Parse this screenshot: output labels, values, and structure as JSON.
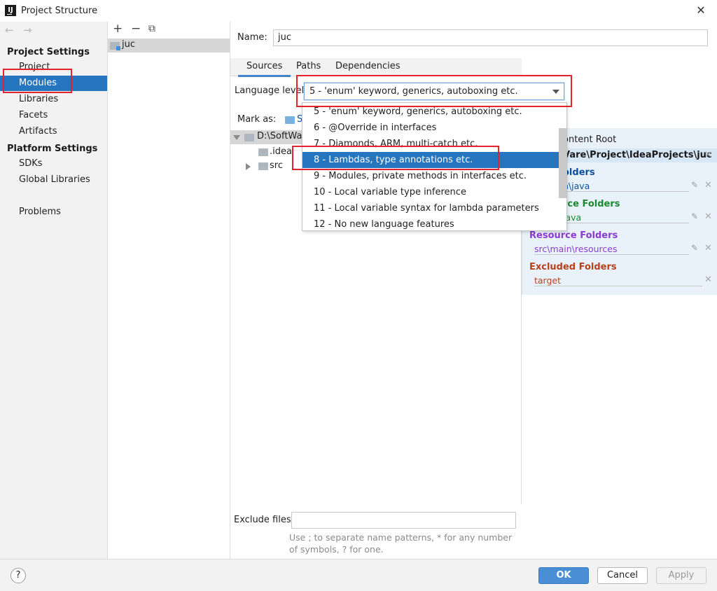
{
  "window": {
    "title": "Project Structure",
    "icon_text": "IJ"
  },
  "sidebar": {
    "back": "←",
    "forward": "→",
    "project_settings_label": "Project Settings",
    "project_items": [
      "Project",
      "Modules",
      "Libraries",
      "Facets",
      "Artifacts"
    ],
    "platform_settings_label": "Platform Settings",
    "platform_items": [
      "SDKs",
      "Global Libraries"
    ],
    "problems": "Problems",
    "selected": "Modules"
  },
  "modules": {
    "add": "+",
    "remove": "−",
    "copy": "⧉",
    "list": [
      "juc"
    ]
  },
  "module_settings": {
    "name_label": "Name:",
    "name_value": "juc",
    "tabs": [
      "Sources",
      "Paths",
      "Dependencies"
    ],
    "active_tab": "Sources",
    "language_level_label": "Language level:",
    "language_level_value": "5 - 'enum' keyword, generics, autoboxing etc.",
    "mark_as_label": "Mark as:",
    "mark_as_first": "S",
    "tree": {
      "root": "D:\\SoftWare\\Project\\IdeaProjects\\juc",
      "root_visible": "D:\\SoftWar",
      "children": [
        ".idea",
        "src"
      ]
    },
    "content_root": {
      "add_label": "+ Add Content Root",
      "header_visible": "ontent Root",
      "path_visible": "Vare\\Project\\IdeaProjects\\juc",
      "source_folders_label": "Source Folders",
      "source_folders_visible": "olders",
      "source_path_visible": "n\\java",
      "test_folders_label": "Test Source Folders",
      "test_folders_visible": "rce Folders",
      "test_path_visible": "java",
      "resource_folders_label": "Resource Folders",
      "resource_path": "src\\main\\resources",
      "excluded_folders_label": "Excluded Folders",
      "excluded_path": "target"
    },
    "exclude_files_label": "Exclude files:",
    "exclude_files_value": "",
    "exclude_hint": "Use ; to separate name patterns, * for any number of symbols, ? for one."
  },
  "language_dropdown": {
    "options": [
      "5 - 'enum' keyword, generics, autoboxing etc.",
      "6 - @Override in interfaces",
      "7 - Diamonds, ARM, multi-catch etc.",
      "8 - Lambdas, type annotations etc.",
      "9 - Modules, private methods in interfaces etc.",
      "10 - Local variable type inference",
      "11 - Local variable syntax for lambda parameters",
      "12 - No new language features"
    ],
    "highlighted": "8 - Lambdas, type annotations etc."
  },
  "footer": {
    "help": "?",
    "ok": "OK",
    "cancel": "Cancel",
    "apply": "Apply"
  },
  "colors": {
    "selection": "#2675bf",
    "source_folders": "#0b4f9c",
    "test_folders": "#1a8a2c",
    "resource_folders": "#8a3ad1",
    "excluded_folders": "#b8401a",
    "annotation_box": "#e3232c"
  }
}
